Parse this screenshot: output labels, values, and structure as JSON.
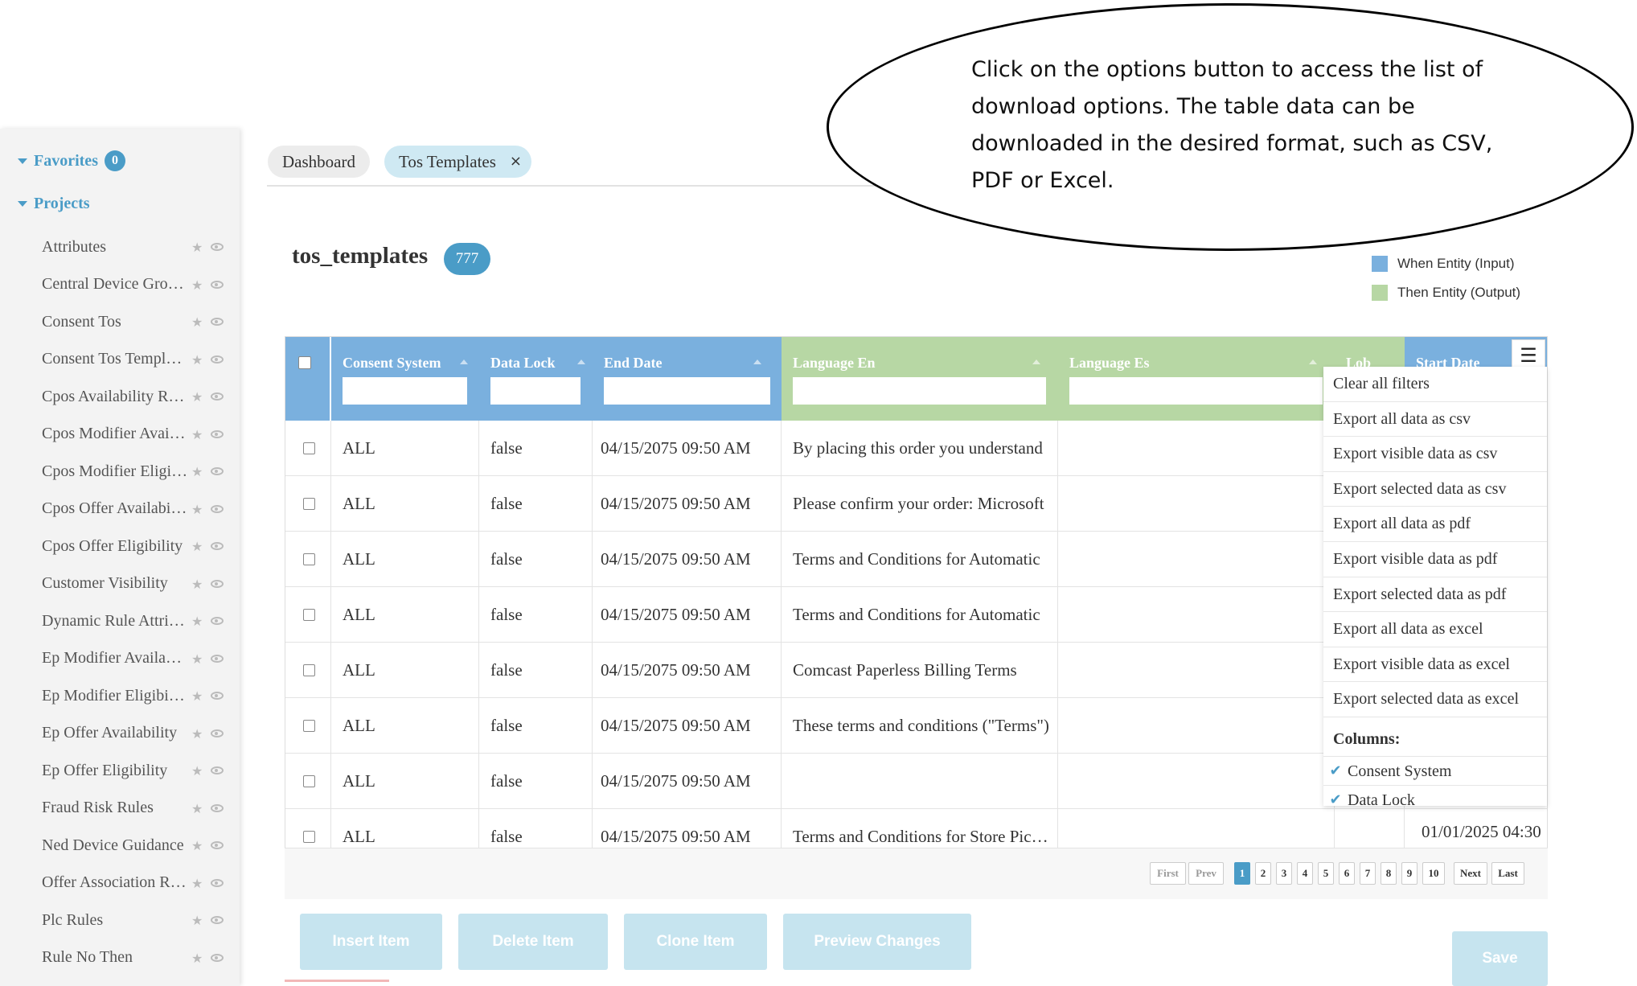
{
  "sidebar": {
    "favorites": {
      "label": "Favorites",
      "count": "0"
    },
    "projects_label": "Projects",
    "items": [
      {
        "label": "Attributes"
      },
      {
        "label": "Central Device Groups"
      },
      {
        "label": "Consent Tos"
      },
      {
        "label": "Consent Tos Templates"
      },
      {
        "label": "Cpos Availability Rules"
      },
      {
        "label": "Cpos Modifier Availability"
      },
      {
        "label": "Cpos Modifier Eligibility"
      },
      {
        "label": "Cpos Offer Availability"
      },
      {
        "label": "Cpos Offer Eligibility"
      },
      {
        "label": "Customer Visibility"
      },
      {
        "label": "Dynamic Rule Attributes"
      },
      {
        "label": "Ep Modifier Availability"
      },
      {
        "label": "Ep Modifier Eligibility"
      },
      {
        "label": "Ep Offer Availability"
      },
      {
        "label": "Ep Offer Eligibility"
      },
      {
        "label": "Fraud Risk Rules"
      },
      {
        "label": "Ned Device Guidance"
      },
      {
        "label": "Offer Association Rules"
      },
      {
        "label": "Plc Rules"
      },
      {
        "label": "Rule No Then"
      }
    ]
  },
  "tabs": [
    {
      "label": "Dashboard"
    },
    {
      "label": "Tos Templates",
      "close": "×"
    }
  ],
  "page": {
    "title": "tos_templates",
    "count": "777"
  },
  "legend": [
    {
      "label": "When Entity (Input)",
      "color": "#7ab0de"
    },
    {
      "label": "Then Entity (Output)",
      "color": "#b7d7a4"
    }
  ],
  "table": {
    "columns": [
      {
        "label": "Consent System",
        "group": "input"
      },
      {
        "label": "Data Lock",
        "group": "input"
      },
      {
        "label": "End Date",
        "group": "input"
      },
      {
        "label": "Language En",
        "group": "output"
      },
      {
        "label": "Language Es",
        "group": "output"
      },
      {
        "label": "Lob",
        "group": "output"
      },
      {
        "label": "Start Date",
        "group": "input"
      }
    ],
    "rows": [
      {
        "consent_system": "ALL",
        "data_lock": "false",
        "end_date": "04/15/2075 09:50 AM",
        "language_en": "By placing this order you understand"
      },
      {
        "consent_system": "ALL",
        "data_lock": "false",
        "end_date": "04/15/2075 09:50 AM",
        "language_en": "Please confirm your order: Microsoft"
      },
      {
        "consent_system": "ALL",
        "data_lock": "false",
        "end_date": "04/15/2075 09:50 AM",
        "language_en": "Terms and Conditions for Automatic"
      },
      {
        "consent_system": "ALL",
        "data_lock": "false",
        "end_date": "04/15/2075 09:50 AM",
        "language_en": "Terms and Conditions for Automatic"
      },
      {
        "consent_system": "ALL",
        "data_lock": "false",
        "end_date": "04/15/2075 09:50 AM",
        "language_en": "Comcast Paperless Billing Terms"
      },
      {
        "consent_system": "ALL",
        "data_lock": "false",
        "end_date": "04/15/2075 09:50 AM",
        "language_en": "These terms and conditions (\"Terms\")"
      },
      {
        "consent_system": "ALL",
        "data_lock": "false",
        "end_date": "04/15/2075 09:50 AM",
        "language_en": ""
      },
      {
        "consent_system": "ALL",
        "data_lock": "false",
        "end_date": "04/15/2075 09:50 AM",
        "language_en": "Terms and Conditions for Store Pickup"
      }
    ],
    "last_start_date": "01/01/2025 04:30"
  },
  "options": {
    "button_icon": "☰",
    "icon_name": "hamburger-icon",
    "items": [
      {
        "label": "Clear all filters"
      },
      {
        "label": "Export all data as csv"
      },
      {
        "label": "Export visible data as csv"
      },
      {
        "label": "Export selected data as csv"
      },
      {
        "label": "Export all data as pdf"
      },
      {
        "label": "Export visible data as pdf"
      },
      {
        "label": "Export selected data as pdf"
      },
      {
        "label": "Export all data as excel"
      },
      {
        "label": "Export visible data as excel"
      },
      {
        "label": "Export selected data as excel"
      }
    ],
    "columns_label": "Columns:",
    "column_options": [
      {
        "label": "Consent System",
        "check": "✔"
      },
      {
        "label": "Data Lock",
        "check": "✔"
      }
    ]
  },
  "pagination": {
    "first": "First",
    "prev": "Prev",
    "next": "Next",
    "last": "Last",
    "pages": [
      "1",
      "2",
      "3",
      "4",
      "5",
      "6",
      "7",
      "8",
      "9",
      "10"
    ],
    "current": "1"
  },
  "actions": {
    "insert": "Insert Item",
    "delete": "Delete Item",
    "clone": "Clone Item",
    "preview": "Preview Changes",
    "save": "Save"
  },
  "callout": {
    "text": "Click on the options button to access the list of download options. The table data can be downloaded in the desired format, such as CSV, PDF or Excel."
  }
}
